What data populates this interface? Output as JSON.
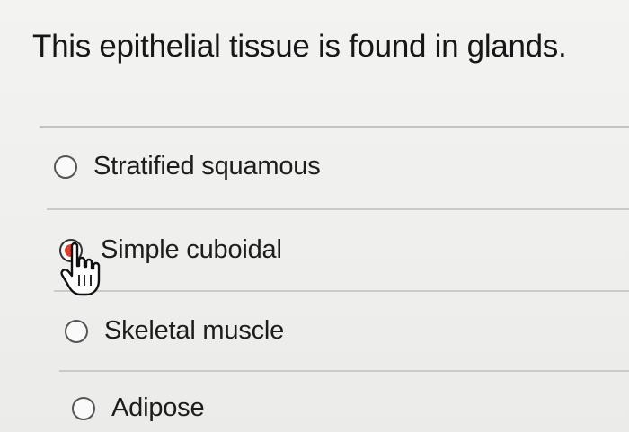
{
  "question": {
    "text": "This epithelial tissue is found in glands."
  },
  "options": [
    {
      "label": "Stratified squamous",
      "selected": false
    },
    {
      "label": "Simple cuboidal",
      "selected": true
    },
    {
      "label": "Skeletal muscle",
      "selected": false
    },
    {
      "label": "Adipose",
      "selected": false
    }
  ],
  "cursor": {
    "icon": "hand-pointer-icon"
  },
  "colors": {
    "selected_radio": "#d9412b",
    "divider": "#c9cbc7",
    "background": "#f1f2f0"
  }
}
